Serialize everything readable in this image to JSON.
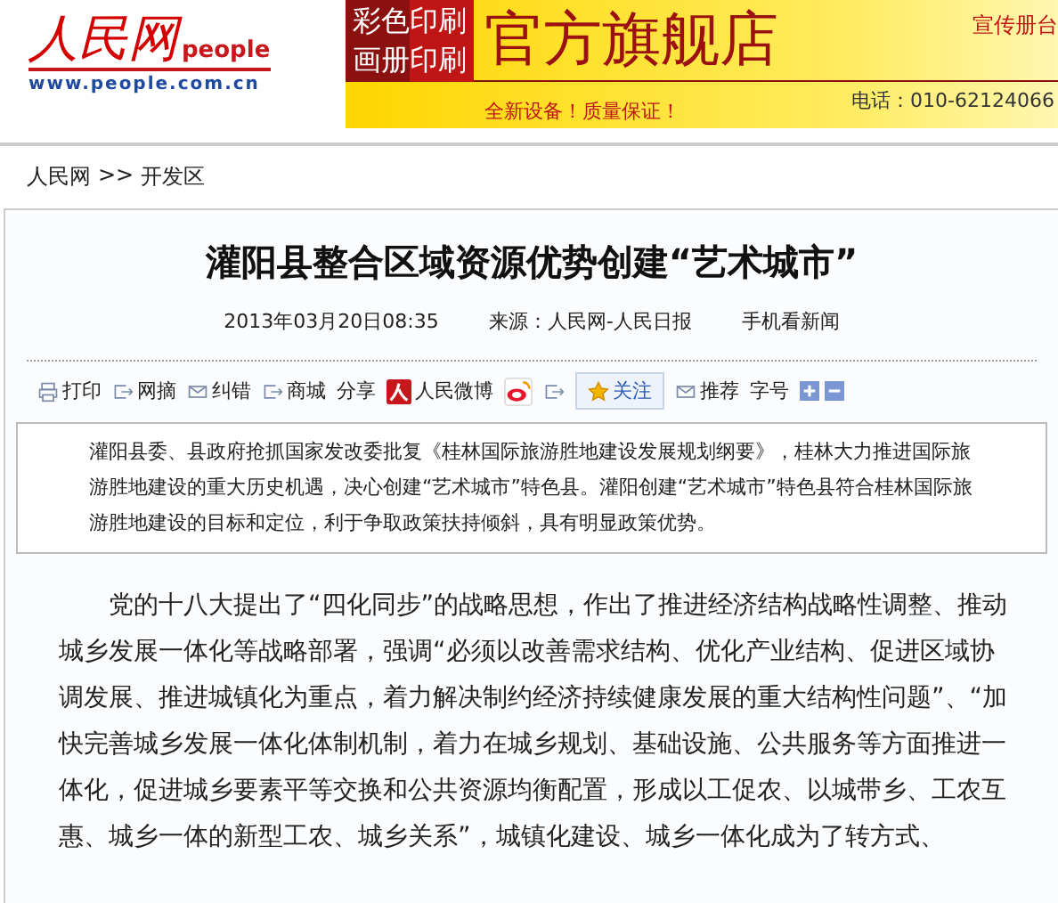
{
  "logo": {
    "name": "人民网",
    "brand": "people",
    "url": "www.people.com.cn"
  },
  "ad": {
    "tag_lines": [
      "彩色印刷",
      "画册印刷"
    ],
    "headline": "官方旗舰店",
    "side": "宣传册台",
    "phone": "电话：010-62124066",
    "slogan": "全新设备！质量保证！"
  },
  "breadcrumb": {
    "home": "人民网",
    "separator": ">>",
    "section": "开发区"
  },
  "article": {
    "title": "灌阳县整合区域资源优势创建“艺术城市”",
    "date": "2013年03月20日08:35",
    "source": "来源：人民网-人民日报",
    "mobile": "手机看新闻",
    "toolbar": [
      {
        "kind": "print",
        "label": "打印"
      },
      {
        "kind": "out",
        "label": "网摘"
      },
      {
        "kind": "mail",
        "label": "纠错"
      },
      {
        "kind": "out",
        "label": "商城"
      },
      {
        "kind": "plain",
        "label": "分享"
      },
      {
        "kind": "people",
        "label": "人民微博"
      },
      {
        "kind": "sina"
      },
      {
        "kind": "out"
      },
      {
        "kind": "follow",
        "label": "关注"
      },
      {
        "kind": "mail",
        "label": "推荐"
      },
      {
        "kind": "plain",
        "label": "字号"
      },
      {
        "kind": "plus"
      },
      {
        "kind": "minus"
      }
    ],
    "summary": "灌阳县委、县政府抢抓国家发改委批复《桂林国际旅游胜地建设发展规划纲要》，桂林大力推进国际旅游胜地建设的重大历史机遇，决心创建“艺术城市”特色县。灌阳创建“艺术城市”特色县符合桂林国际旅游胜地建设的目标和定位，利于争取政策扶持倾斜，具有明显政策优势。",
    "paragraphs": [
      "党的十八大提出了“四化同步”的战略思想，作出了推进经济结构战略性调整、推动城乡发展一体化等战略部署，强调“必须以改善需求结构、优化产业结构、促进区域协调发展、推进城镇化为重点，着力解决制约经济持续健康发展的重大结构性问题”、“加快完善城乡发展一体化体制机制，着力在城乡规划、基础设施、公共服务等方面推进一体化，促进城乡要素平等交换和公共资源均衡配置，形成以工促农、以城带乡、工农互惠、城乡一体的新型工农、城乡关系”，城镇化建设、城乡一体化成为了转方式、"
    ]
  }
}
